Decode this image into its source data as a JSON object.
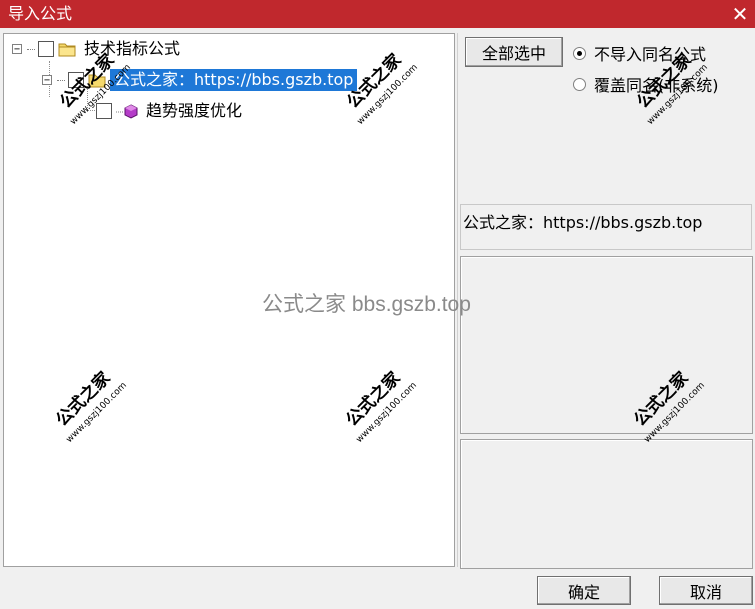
{
  "window": {
    "title": "导入公式",
    "close_label": "✕"
  },
  "tree": {
    "root_label": "技术指标公式",
    "root_expander": "−",
    "child_label": "公式之家：https://bbs.gszb.top",
    "child_expander": "−",
    "grandchild_label": "趋势强度优化"
  },
  "actions": {
    "select_all_label": "全部选中",
    "radio_no_import_label": "不导入同名公式",
    "radio_overwrite_label": "覆盖同名(非系统)",
    "ok_label": "确定",
    "cancel_label": "取消"
  },
  "info": {
    "description": "公式之家：https://bbs.gszb.top"
  },
  "watermark": {
    "center_text": "公式之家 bbs.gszb.top",
    "stamp_main": "公式之家",
    "stamp_url": "www.gszj100.com"
  },
  "colors": {
    "titlebar": "#c0282d",
    "selection": "#1e78d7",
    "stamp_text": "#000000"
  }
}
